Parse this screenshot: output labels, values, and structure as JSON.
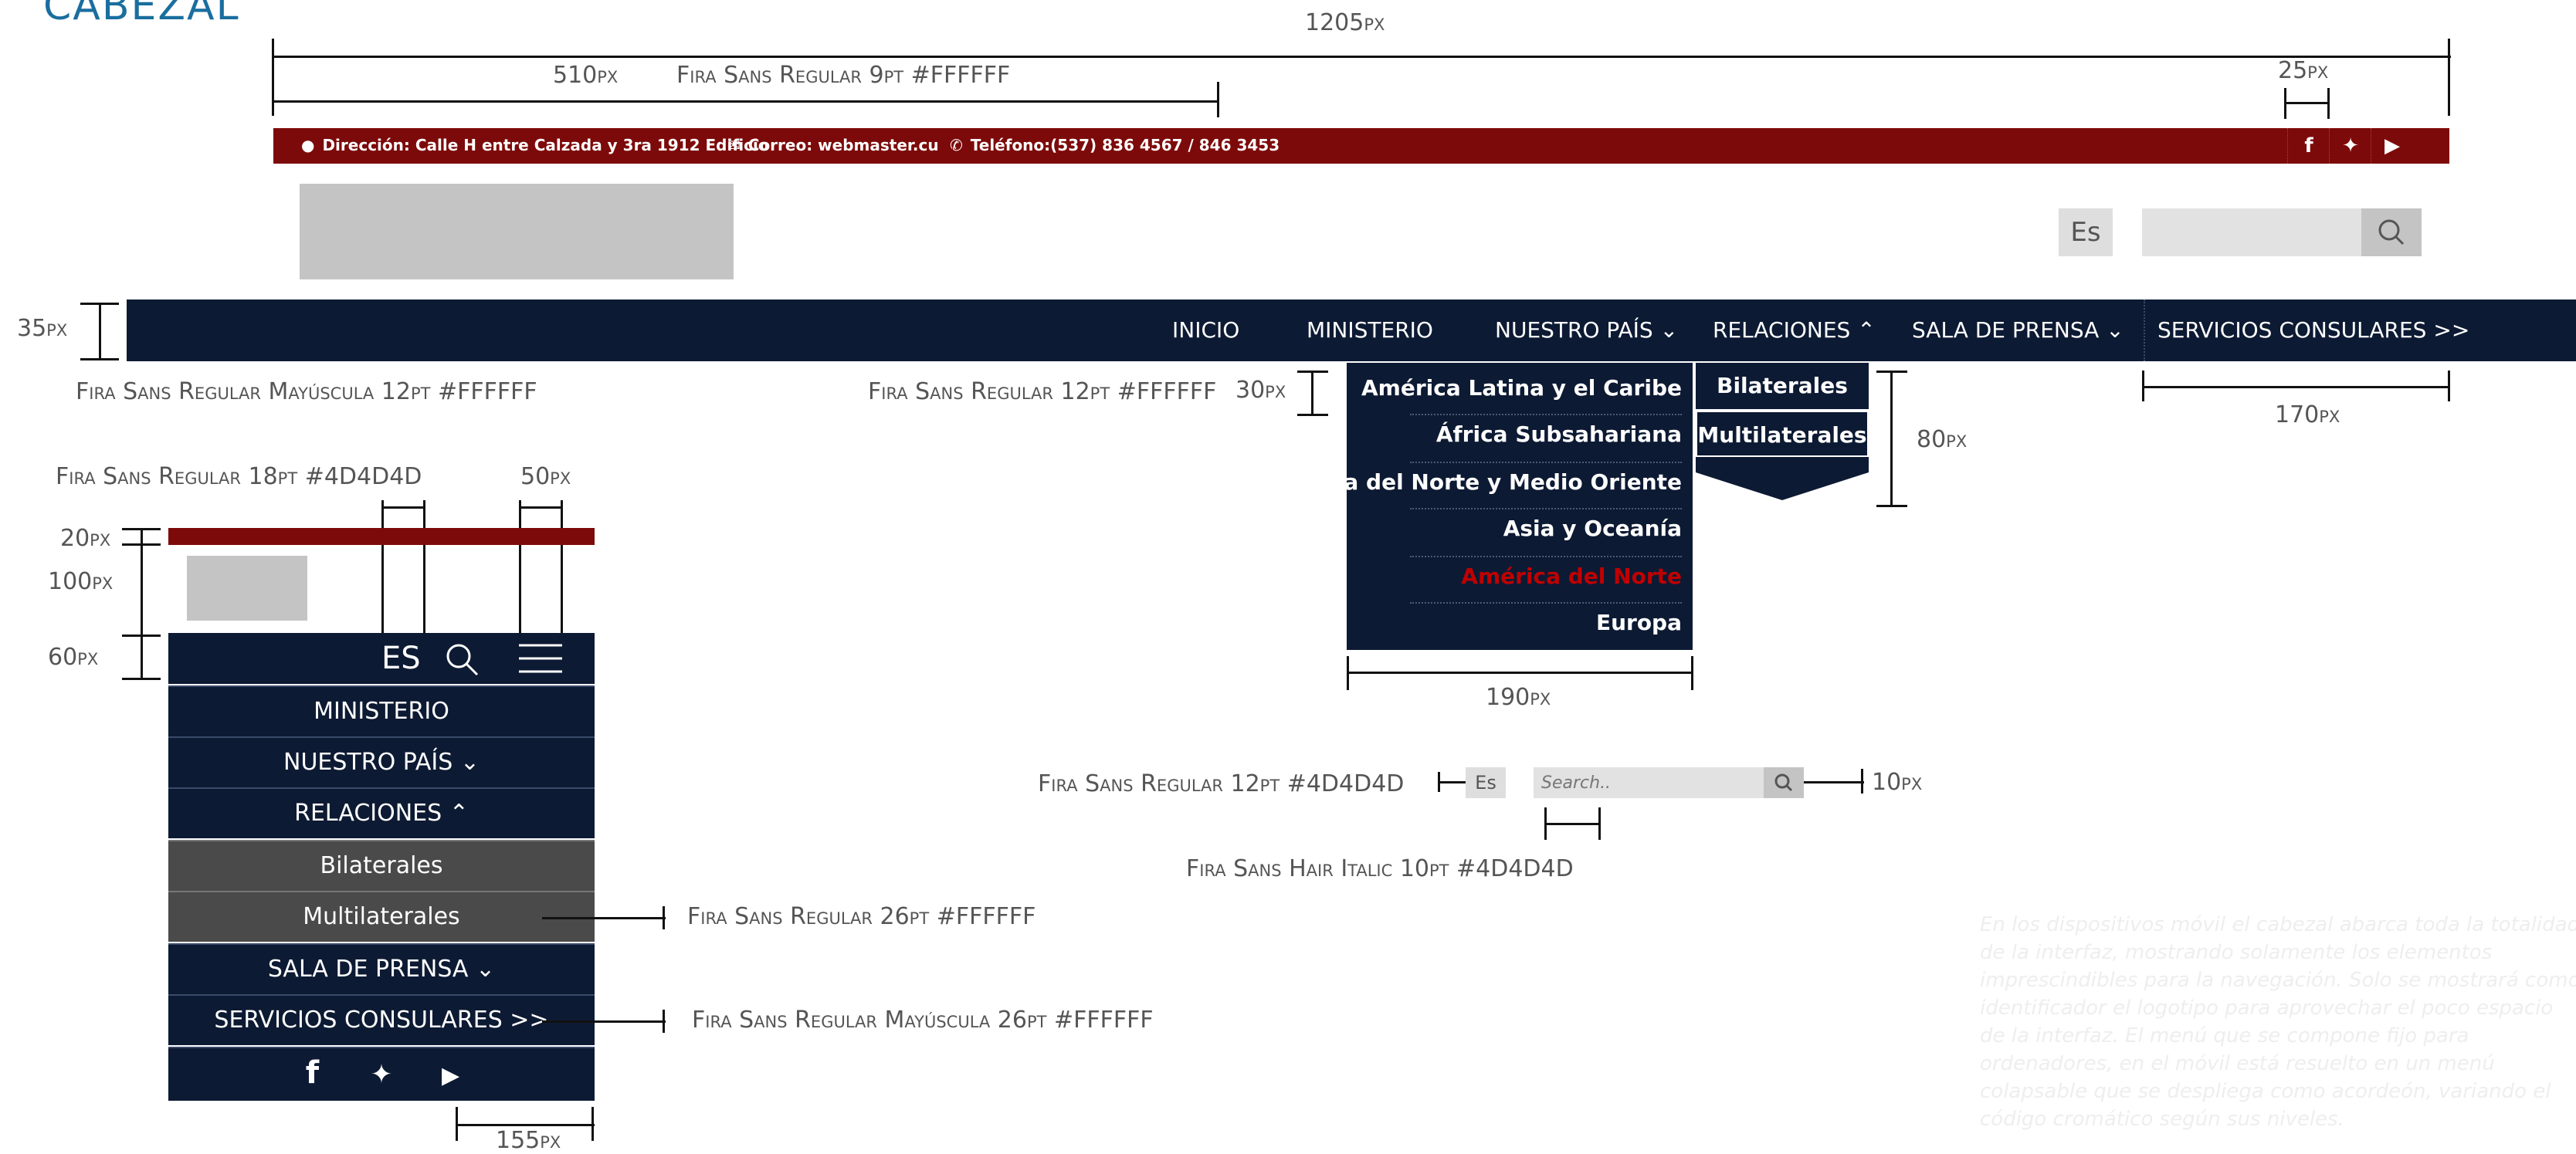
{
  "page_title": "CABEZAL",
  "colors": {
    "brand_red": "#7d0a0a",
    "nav_navy": "#0d1a33",
    "active_red": "#c00000",
    "submenu_gray": "#4a4a4a",
    "placeholder_gray": "#c4c4c4",
    "annotation_blue": "#1a6e9e"
  },
  "topbar": {
    "address": "Dirección: Calle H entre Calzada y 3ra 1912 Edificio",
    "email": "Correo: webmaster.cu",
    "phone": "Teléfono:(537) 836 4567 / 846 3453",
    "social_icons": [
      "facebook-icon",
      "twitter-icon",
      "youtube-icon"
    ]
  },
  "header": {
    "lang": "Es"
  },
  "nav": {
    "items": [
      "INICIO",
      "MINISTERIO",
      "NUESTRO PAÍS",
      "RELACIONES",
      "SALA DE PRENSA",
      "SERVICIOS CONSULARES"
    ],
    "consulares_suffix": ">>"
  },
  "dropdown": {
    "items": [
      "América Latina y el Caribe",
      "África Subsahariana",
      "África del Norte y Medio Oriente",
      "Asia y Oceanía",
      "América del Norte",
      "Europa"
    ],
    "active_item": "América del Norte",
    "sub": [
      "Bilaterales",
      "Multilaterales"
    ]
  },
  "small_search": {
    "lang": "Es",
    "placeholder": "Search.."
  },
  "mobile": {
    "lang": "ES",
    "items": [
      "MINISTERIO",
      "NUESTRO PAÍS",
      "RELACIONES",
      "Bilaterales",
      "Multilaterales",
      "SALA DE PRENSA",
      "SERVICIOS CONSULARES >>"
    ]
  },
  "annotations": {
    "width_1205": "1205px",
    "width_510": "510px",
    "font_topbar": "Fira Sans Regular 9pt #FFFFFF",
    "width_25": "25px",
    "height_35": "35px",
    "font_nav": "Fira Sans Regular Mayúscula 12pt #FFFFFF",
    "font_dropdown": "Fira Sans Regular 12pt #FFFFFF",
    "height_30": "30px",
    "height_80": "80px",
    "width_170": "170px",
    "font_mobile_lang": "Fira Sans Regular 18pt #4D4D4D",
    "width_50": "50px",
    "height_20": "20px",
    "height_100": "100px",
    "height_60": "60px",
    "width_190": "190px",
    "font_small_search": "Fira Sans Regular 12pt #4D4D4D",
    "height_10": "10px",
    "font_search_placeholder": "Fira Sans Hair Italic 10pt #4D4D4D",
    "font_mobile_sub": "Fira Sans Regular 26pt #FFFFFF",
    "font_mobile_nav": "Fira Sans Regular Mayúscula 26pt #FFFFFF",
    "width_155": "155px"
  },
  "note": "En los dispositivos móvil el cabezal abarca toda la totalidad de la interfaz, mostrando solamente los elementos imprescindibles para la navegación. Solo se mostrará como identificador el logotipo para aprovechar el poco espacio de la interfaz. El menú que se compone fijo para ordenadores, en el móvil está resuelto en un menú colapsable que se despliega como acordeón, variando el código cromático según sus niveles."
}
